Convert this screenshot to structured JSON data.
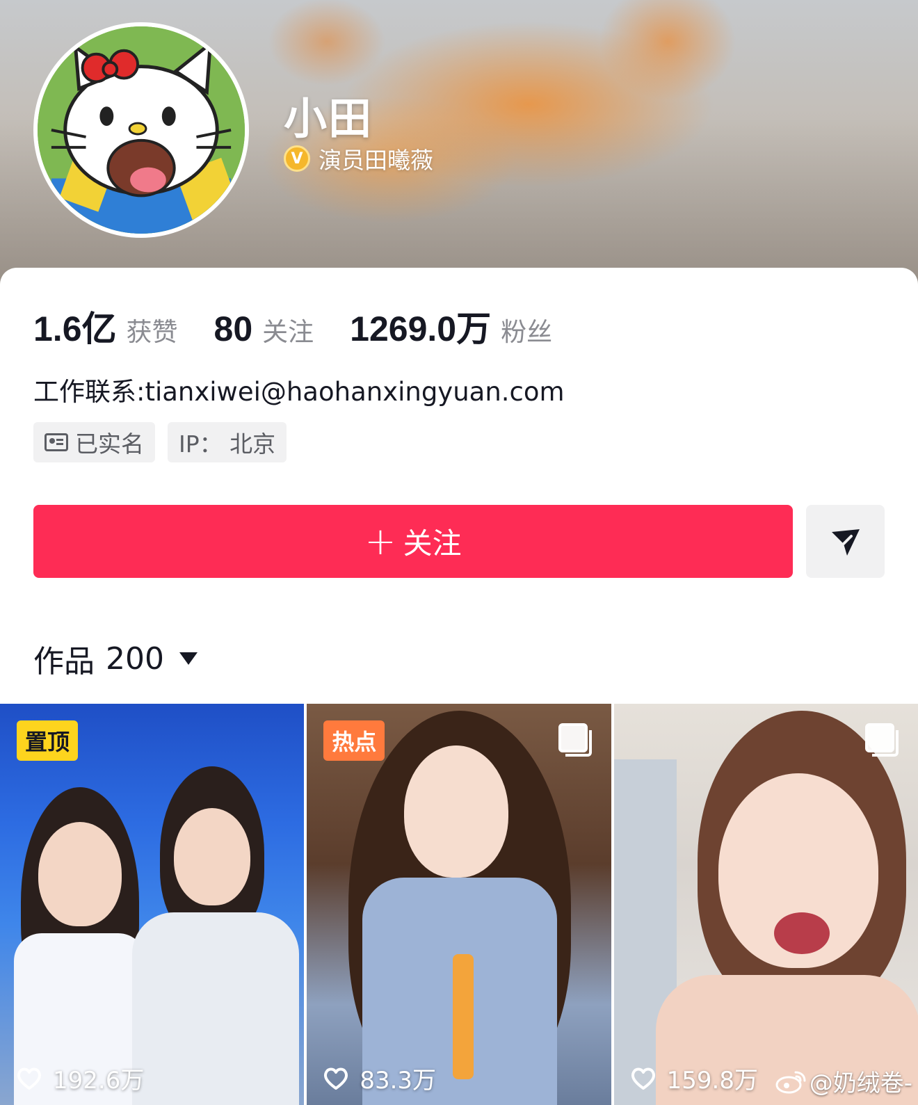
{
  "profile": {
    "nickname": "小田",
    "verified_text": "演员田曦薇",
    "verified_badge": "V"
  },
  "stats": [
    {
      "number": "1.6亿",
      "label": "获赞"
    },
    {
      "number": "80",
      "label": "关注"
    },
    {
      "number": "1269.0万",
      "label": "粉丝"
    }
  ],
  "bio": "工作联系:tianxiwei@haohanxingyuan.com",
  "tags": {
    "realname": "已实名",
    "ip": "IP：  北京"
  },
  "actions": {
    "follow_plus": "+",
    "follow_label": "关注"
  },
  "works": {
    "title": "作品",
    "count": "200"
  },
  "videos": [
    {
      "badge": "置顶",
      "likes": "192.6万",
      "multi": false
    },
    {
      "badge": "热点",
      "likes": "83.3万",
      "multi": true
    },
    {
      "badge": "",
      "likes": "159.8万",
      "multi": true
    }
  ],
  "watermark": "@奶绒卷-",
  "colors": {
    "follow_button": "#fe2c55",
    "pin_badge": "#fdd41e",
    "hot_badge": "#ff7a3d",
    "verified_badge": "#f5b72b"
  },
  "icons": [
    "verified-v-icon",
    "id-card-icon",
    "send-icon",
    "dropdown-caret-icon",
    "multi-image-icon",
    "heart-icon",
    "weibo-logo"
  ]
}
